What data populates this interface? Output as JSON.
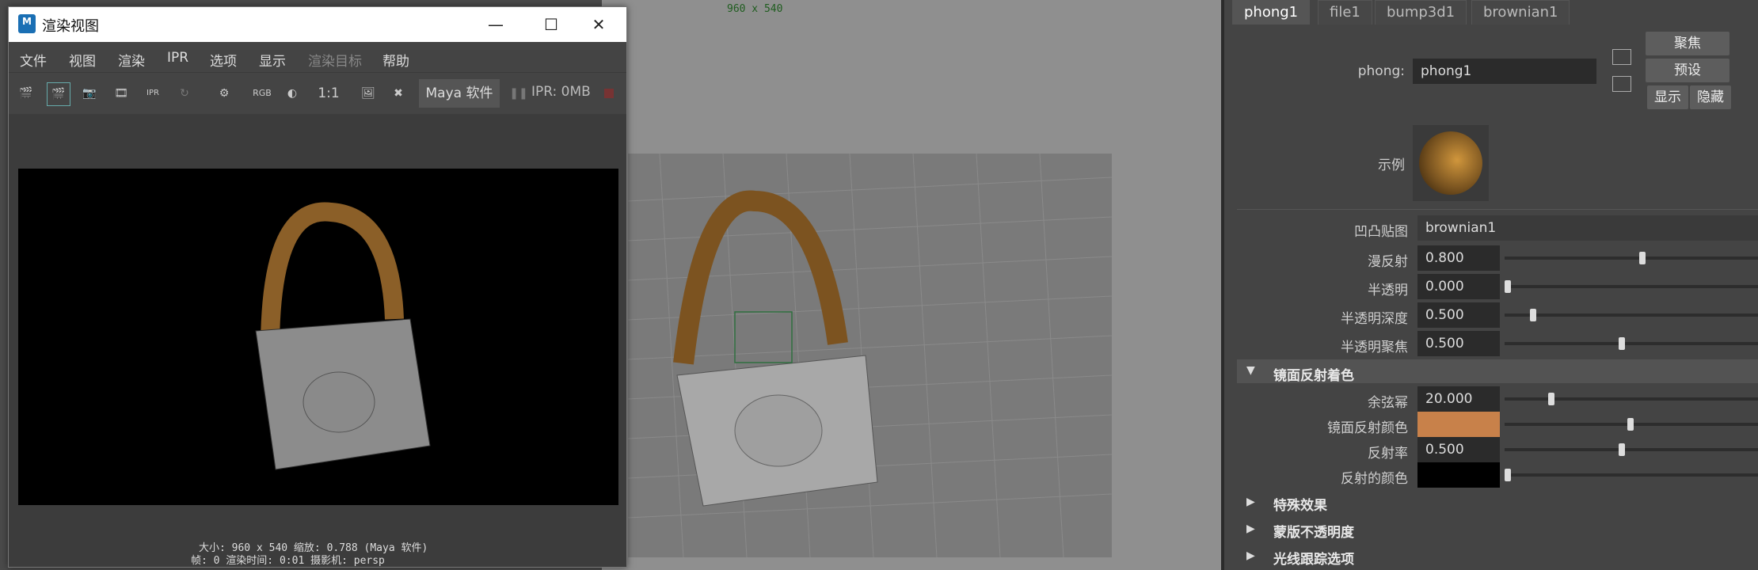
{
  "viewport": {
    "resolution": "960 x 540"
  },
  "render_window": {
    "title": "渲染视图",
    "logo": "M",
    "menu": [
      "文件",
      "视图",
      "渲染",
      "IPR",
      "选项",
      "显示",
      "渲染目标",
      "帮助"
    ],
    "toolbar": {
      "ratio": "1:1",
      "rgb": "RGB",
      "renderer": "Maya 软件",
      "ipr_mem": "IPR: 0MB"
    },
    "info_line1": "大小: 960 x 540 缩放: 0.788        (Maya 软件)",
    "info_line2": "帧: 0       渲染时间: 0:01      摄影机: persp"
  },
  "attr_editor": {
    "tabs": [
      "phong1",
      "file1",
      "bump3d1",
      "brownian1"
    ],
    "type_label": "phong:",
    "node_name": "phong1",
    "buttons": {
      "focus": "聚焦",
      "presets": "预设",
      "show": "显示",
      "hide": "隐藏"
    },
    "sample_label": "示例",
    "bump_label": "凹凸贴图",
    "bump_value": "brownian1",
    "attrs": [
      {
        "label": "漫反射",
        "value": "0.800",
        "slider": 0.8
      },
      {
        "label": "半透明",
        "value": "0.000",
        "slider": 0.0
      },
      {
        "label": "半透明深度",
        "value": "0.500",
        "slider": 0.15
      },
      {
        "label": "半透明聚焦",
        "value": "0.500",
        "slider": 0.68
      }
    ],
    "spec_section": "镜面反射着色",
    "spec_attrs": [
      {
        "label": "余弦幂",
        "value": "20.000",
        "slider": 0.26
      },
      {
        "label": "镜面反射颜色",
        "value": "",
        "color": "#c8814a",
        "slider": 0.73
      },
      {
        "label": "反射率",
        "value": "0.500",
        "slider": 0.68
      },
      {
        "label": "反射的颜色",
        "value": "",
        "color": "#000000",
        "slider": 0.0
      }
    ],
    "collapsed_sections": [
      "特殊效果",
      "蒙版不透明度",
      "光线跟踪选项"
    ]
  }
}
